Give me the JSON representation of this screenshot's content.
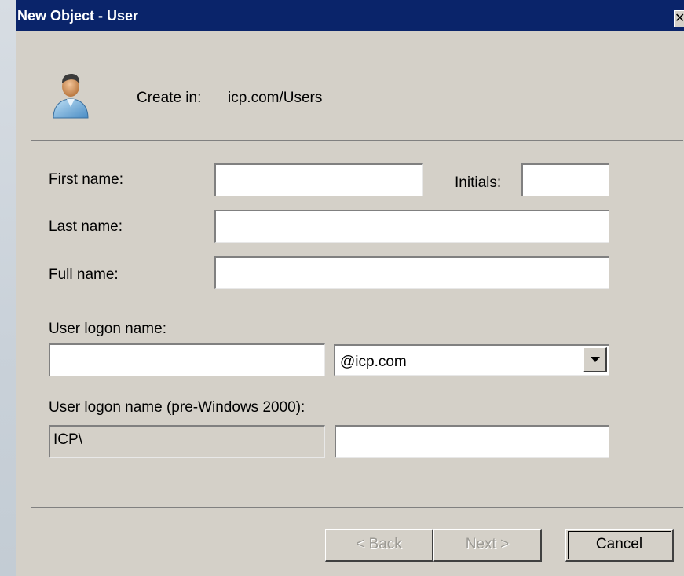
{
  "window": {
    "title": "New Object - User",
    "close_glyph": "✕"
  },
  "header": {
    "create_in_label": "Create in:",
    "create_in_value": "icp.com/Users",
    "icon": "user-icon"
  },
  "form": {
    "first_name_label": "First name:",
    "first_name_value": "",
    "initials_label": "Initials:",
    "initials_value": "",
    "last_name_label": "Last name:",
    "last_name_value": "",
    "full_name_label": "Full name:",
    "full_name_value": "",
    "logon_label": "User logon name:",
    "logon_value": "",
    "domain_suffix": "@icp.com",
    "pre2000_label": "User logon name (pre-Windows 2000):",
    "pre2000_domain": "ICP\\",
    "pre2000_value": ""
  },
  "buttons": {
    "back": "< Back",
    "next": "Next >",
    "cancel": "Cancel"
  },
  "colors": {
    "titlebar": "#0a246a",
    "dialog_bg": "#d4d0c8",
    "title_text": "#ffffff"
  }
}
